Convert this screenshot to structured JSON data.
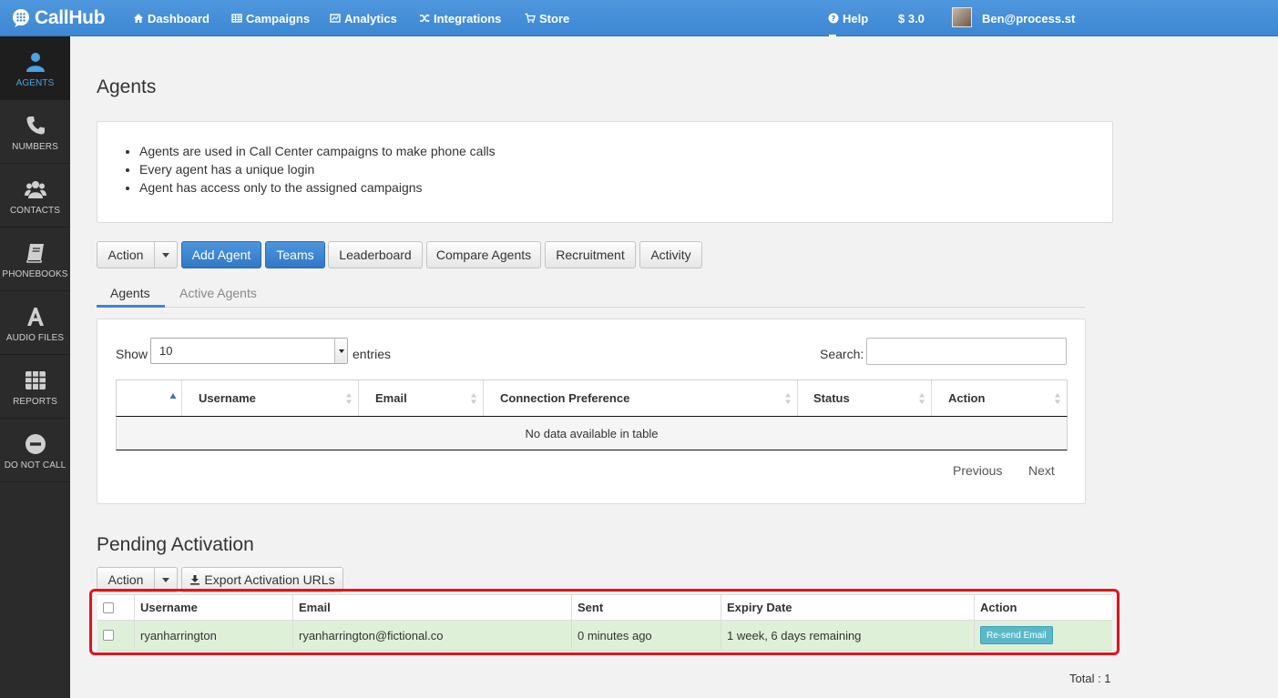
{
  "brand": {
    "name": "CallHub"
  },
  "nav": {
    "items": [
      {
        "label": "Dashboard",
        "icon": "home-icon"
      },
      {
        "label": "Campaigns",
        "icon": "table-icon"
      },
      {
        "label": "Analytics",
        "icon": "chart-icon"
      },
      {
        "label": "Integrations",
        "icon": "shuffle-icon"
      },
      {
        "label": "Store",
        "icon": "cart-icon"
      }
    ],
    "help": "Help",
    "balance": "$ 3.0",
    "user": "Ben@process.st"
  },
  "sidebar": {
    "items": [
      {
        "label": "AGENTS",
        "icon": "user-icon",
        "active": true
      },
      {
        "label": "NUMBERS",
        "icon": "phone-icon"
      },
      {
        "label": "CONTACTS",
        "icon": "group-icon"
      },
      {
        "label": "PHONEBOOKS",
        "icon": "book-icon"
      },
      {
        "label": "AUDIO FILES",
        "icon": "font-icon"
      },
      {
        "label": "REPORTS",
        "icon": "grid-icon"
      },
      {
        "label": "DO NOT CALL",
        "icon": "minus-circle-icon"
      }
    ]
  },
  "page": {
    "title": "Agents",
    "info": [
      "Agents are used in Call Center campaigns to make phone calls",
      "Every agent has a unique login",
      "Agent has access only to the assigned campaigns"
    ]
  },
  "toolbar": {
    "action": "Action",
    "add_agent": "Add Agent",
    "teams": "Teams",
    "leaderboard": "Leaderboard",
    "compare": "Compare Agents",
    "recruitment": "Recruitment",
    "activity": "Activity"
  },
  "tabs": {
    "agents": "Agents",
    "active": "Active Agents"
  },
  "datatable": {
    "show_label": "Show",
    "length_value": "10",
    "entries_label": "entries",
    "search_label": "Search:",
    "columns": [
      "Username",
      "Email",
      "Connection Preference",
      "Status",
      "Action"
    ],
    "empty": "No data available in table",
    "previous": "Previous",
    "next": "Next"
  },
  "pending": {
    "title": "Pending Activation",
    "action": "Action",
    "export": "Export Activation URLs",
    "columns": [
      "Username",
      "Email",
      "Sent",
      "Expiry Date",
      "Action"
    ],
    "rows": [
      {
        "username": "ryanharrington",
        "email": "ryanharrington@fictional.co",
        "sent": "0 minutes ago",
        "expiry": "1 week, 6 days remaining",
        "action": "Re-send Email"
      }
    ],
    "total": "Total : 1"
  },
  "colors": {
    "primary": "#3d87d3",
    "sidebar": "#2b2b2b",
    "row_success": "#dff0d8",
    "highlight": "#e5121d",
    "resend": "#5bb8c8"
  }
}
